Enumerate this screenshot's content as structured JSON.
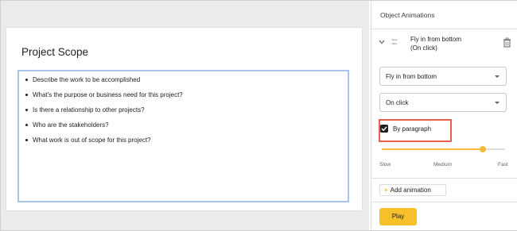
{
  "slide": {
    "title": "Project Scope",
    "bullets": [
      "Describe the work to be accomplished",
      "What's the purpose or business need for this project?",
      "Is there a relationship to other projects?",
      "Who are the stakeholders?",
      "What work is out of scope for this project?"
    ]
  },
  "panel": {
    "title": "Object Animations",
    "animation": {
      "thumb_line1": "- Desc",
      "thumb_line2": "- Wha",
      "name": "Fly in from bottom",
      "trigger": "(On click)"
    },
    "effect_value": "Fly in from bottom",
    "trigger_value": "On click",
    "by_paragraph_label": "By paragraph",
    "by_paragraph_checked": true,
    "speed": {
      "level": 0.82,
      "slow": "Slow",
      "medium": "Medium",
      "fast": "Fast"
    },
    "add_label": "Add animation",
    "play_label": "Play"
  },
  "colors": {
    "accent": "#f6c02b",
    "highlight": "#e8604c",
    "selection": "#a9c5ee"
  },
  "icons": [
    "chevron-down-icon",
    "trash-icon",
    "checkbox-checked-icon",
    "plus-icon",
    "select-caret-icon"
  ]
}
